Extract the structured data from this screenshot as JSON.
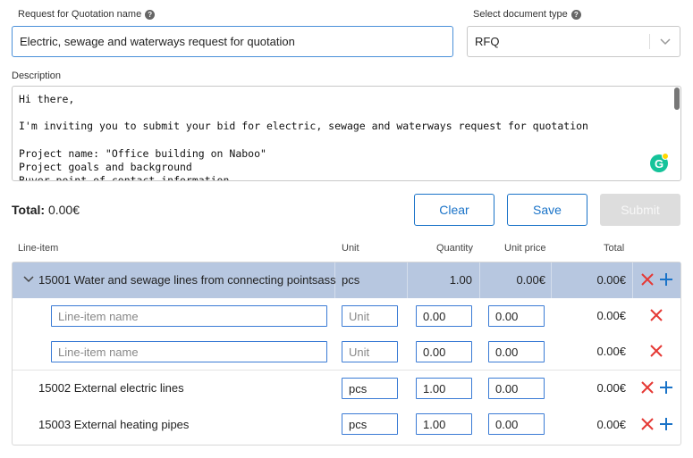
{
  "form": {
    "rfq_name_label": "Request for Quotation name",
    "rfq_name_value": "Electric, sewage and waterways request for quotation",
    "doc_type_label": "Select document type",
    "doc_type_value": "RFQ",
    "description_label": "Description",
    "description_value": "Hi there,\n\nI'm inviting you to submit your bid for electric, sewage and waterways request for quotation\n\nProject name: \"Office building on Naboo\"\nProject goals and background\nBuyer point of contact information"
  },
  "summary": {
    "total_label": "Total:",
    "total_value": "0.00€"
  },
  "buttons": {
    "clear": "Clear",
    "save": "Save",
    "submit": "Submit"
  },
  "table": {
    "headers": {
      "line_item": "Line-item",
      "unit": "Unit",
      "quantity": "Quantity",
      "unit_price": "Unit price",
      "total": "Total"
    },
    "parent": {
      "name": "15001 Water and sewage lines from connecting pointsass",
      "unit": "pcs",
      "quantity": "1.00",
      "unit_price": "0.00€",
      "total": "0.00€"
    },
    "children": [
      {
        "name_placeholder": "Line-item name",
        "unit_placeholder": "Unit",
        "quantity": "0.00",
        "unit_price": "0.00",
        "total": "0.00€"
      },
      {
        "name_placeholder": "Line-item name",
        "unit_placeholder": "Unit",
        "quantity": "0.00",
        "unit_price": "0.00",
        "total": "0.00€"
      }
    ],
    "rows": [
      {
        "name": "15002 External electric lines",
        "unit": "pcs",
        "quantity": "1.00",
        "unit_price": "0.00",
        "total": "0.00€"
      },
      {
        "name": "15003 External heating pipes",
        "unit": "pcs",
        "quantity": "1.00",
        "unit_price": "0.00",
        "total": "0.00€"
      }
    ]
  },
  "colors": {
    "accent": "#1a73c8",
    "delete": "#e53935",
    "parent_row": "#b7c7e0"
  },
  "icons": {
    "help": "question-circle-icon",
    "expand": "chevron-down-icon",
    "delete": "close-icon",
    "add": "plus-icon",
    "grammarly": "grammarly-icon"
  }
}
